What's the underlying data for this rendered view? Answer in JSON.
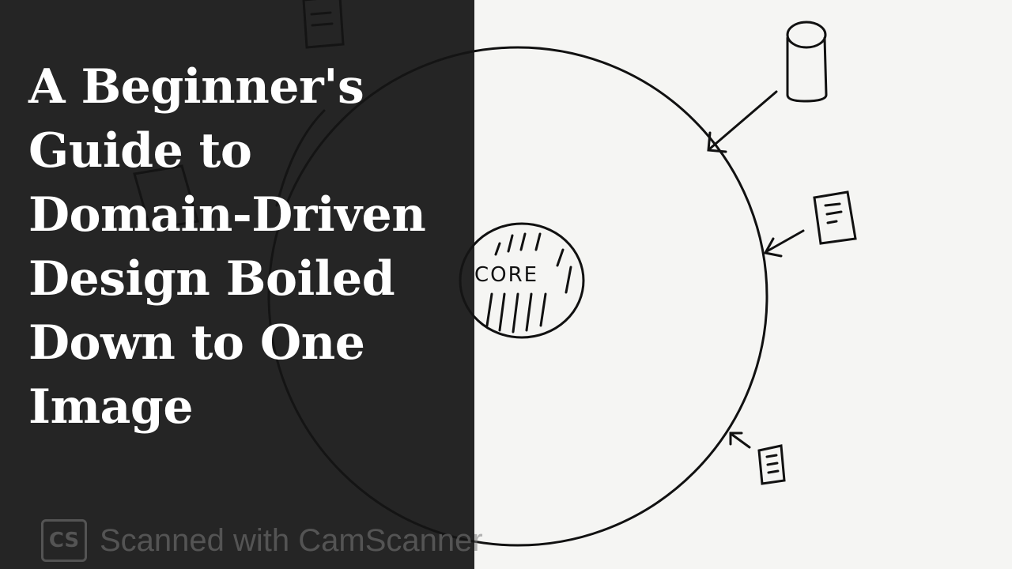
{
  "title": "A Beginner's Guide to Domain-Driven Design Boiled Down to One Image",
  "sketch": {
    "core_label": "CORE"
  },
  "watermark": {
    "logo_text": "CS",
    "text": "Scanned with CamScanner"
  },
  "colors": {
    "overlay": "#141414",
    "ink": "#111111",
    "paper": "#f5f5f3",
    "title_text": "#ffffff"
  }
}
